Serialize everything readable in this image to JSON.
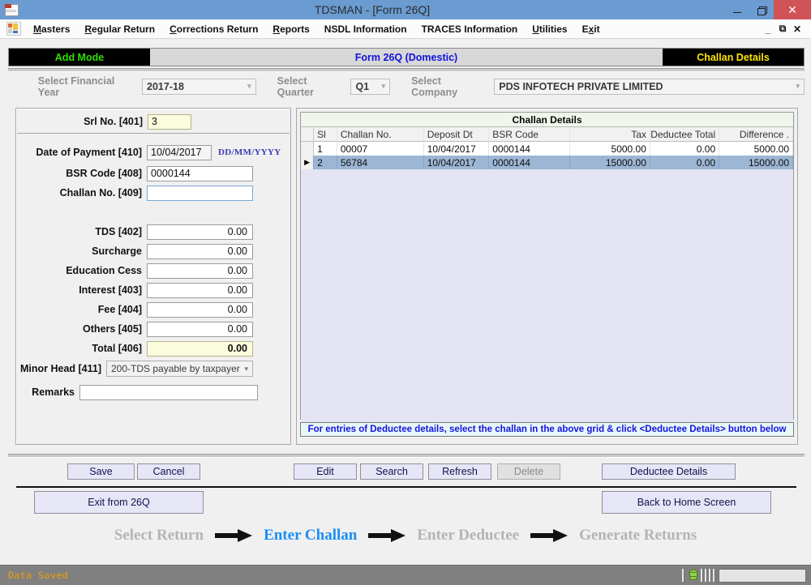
{
  "window": {
    "title": "TDSMAN - [Form 26Q]",
    "icon": "app-document-icon",
    "minimize": "minimize-icon",
    "restore": "restore-icon",
    "close": "close-icon"
  },
  "menubar": {
    "app_icon": "tdsman-logo-icon",
    "items": [
      {
        "label": "Masters",
        "accel": "M"
      },
      {
        "label": "Regular Return",
        "accel": "R"
      },
      {
        "label": "Corrections Return",
        "accel": "C"
      },
      {
        "label": "Reports",
        "accel": "R"
      },
      {
        "label": "NSDL Information",
        "accel": ""
      },
      {
        "label": "TRACES Information",
        "accel": ""
      },
      {
        "label": "Utilities",
        "accel": "U"
      },
      {
        "label": "Exit",
        "accel": "x"
      }
    ],
    "mdi_minimize": "minimize-icon",
    "mdi_restore": "restore-icon",
    "mdi_close": "close-icon"
  },
  "modebar": {
    "mode": "Add Mode",
    "form_title": "Form 26Q (Domestic)",
    "section": "Challan Details",
    "mode_color": "#2fe000",
    "section_color": "#ffe400",
    "form_title_color": "#1111dd"
  },
  "selectors": {
    "financial_year": {
      "label": "Select Financial Year",
      "value": "2017-18"
    },
    "quarter": {
      "label": "Select Quarter",
      "value": "Q1"
    },
    "company": {
      "label": "Select Company",
      "value": "PDS INFOTECH PRIVATE LIMITED"
    }
  },
  "form": {
    "srl_no": {
      "label": "Srl No. [401]",
      "value": "3"
    },
    "date_of_payment": {
      "label": "Date of Payment [410]",
      "value": "10/04/2017",
      "hint": "DD/MM/YYYY"
    },
    "bsr_code": {
      "label": "BSR Code [408]",
      "value": "0000144"
    },
    "challan_no": {
      "label": "Challan No. [409]",
      "value": "",
      "focused": true
    },
    "tds": {
      "label": "TDS [402]",
      "value": "0.00"
    },
    "surcharge": {
      "label": "Surcharge",
      "value": "0.00"
    },
    "education_cess": {
      "label": "Education Cess",
      "value": "0.00"
    },
    "interest": {
      "label": "Interest [403]",
      "value": "0.00"
    },
    "fee": {
      "label": "Fee [404]",
      "value": "0.00"
    },
    "others": {
      "label": "Others [405]",
      "value": "0.00"
    },
    "total": {
      "label": "Total [406]",
      "value": "0.00"
    },
    "minor_head": {
      "label": "Minor Head [411]",
      "value": "200-TDS payable by taxpayer"
    },
    "remarks": {
      "label": "Remarks",
      "value": ""
    }
  },
  "grid": {
    "title": "Challan Details",
    "columns": [
      "Sl",
      "Challan No.",
      "Deposit Dt",
      "BSR Code",
      "Tax",
      "Deductee Total",
      "Difference ."
    ],
    "rows": [
      {
        "sl": "1",
        "challan_no": "00007",
        "deposit_dt": "10/04/2017",
        "bsr_code": "0000144",
        "tax": "5000.00",
        "deductee_total": "0.00",
        "difference": "5000.00",
        "selected": false
      },
      {
        "sl": "2",
        "challan_no": "56784",
        "deposit_dt": "10/04/2017",
        "bsr_code": "0000144",
        "tax": "15000.00",
        "deductee_total": "0.00",
        "difference": "15000.00",
        "selected": true
      }
    ],
    "note": "For entries of Deductee details, select the challan in the above grid & click <Deductee Details> button below",
    "note_color": "#1414e0"
  },
  "buttons": {
    "save": "Save",
    "cancel": "Cancel",
    "edit": "Edit",
    "search": "Search",
    "refresh": "Refresh",
    "delete": "Delete",
    "delete_disabled": true,
    "deductee_details": "Deductee Details",
    "exit_from_26q": "Exit from 26Q",
    "back_to_home": "Back to Home Screen"
  },
  "wizard": {
    "steps": [
      {
        "label": "Select Return",
        "active": false
      },
      {
        "label": "Enter Challan",
        "active": true
      },
      {
        "label": "Enter Deductee",
        "active": false
      },
      {
        "label": "Generate Returns",
        "active": false
      }
    ],
    "active_color": "#1a8ef5",
    "inactive_color": "#b4b4b4"
  },
  "statusbar": {
    "message": "Data Saved",
    "message_color": "#f0a000",
    "db_icon": "database-icon",
    "panel_value": ""
  }
}
